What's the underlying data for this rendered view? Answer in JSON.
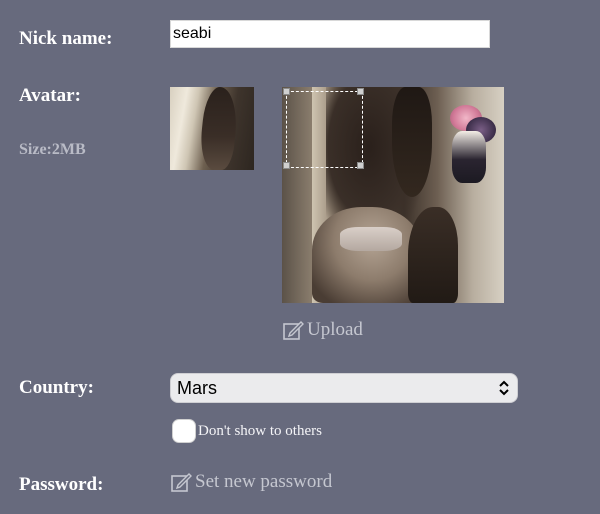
{
  "labels": {
    "nick_name": "Nick name:",
    "avatar": "Avatar:",
    "size": "Size:2MB",
    "country": "Country:",
    "password": "Password:"
  },
  "nickname": {
    "value": "seabi"
  },
  "avatar": {
    "upload_label": "Upload"
  },
  "country": {
    "selected": "Mars"
  },
  "privacy": {
    "hide_country_label": "Don't show to others",
    "checked": false
  },
  "password": {
    "set_new_label": "Set new password"
  },
  "colors": {
    "background": "#676a7d",
    "label_text": "#ffffff",
    "muted_text": "#c5c7d0"
  },
  "icons": {
    "upload": "edit-square-icon",
    "password": "edit-square-icon",
    "select": "chevron-updown-icon"
  }
}
